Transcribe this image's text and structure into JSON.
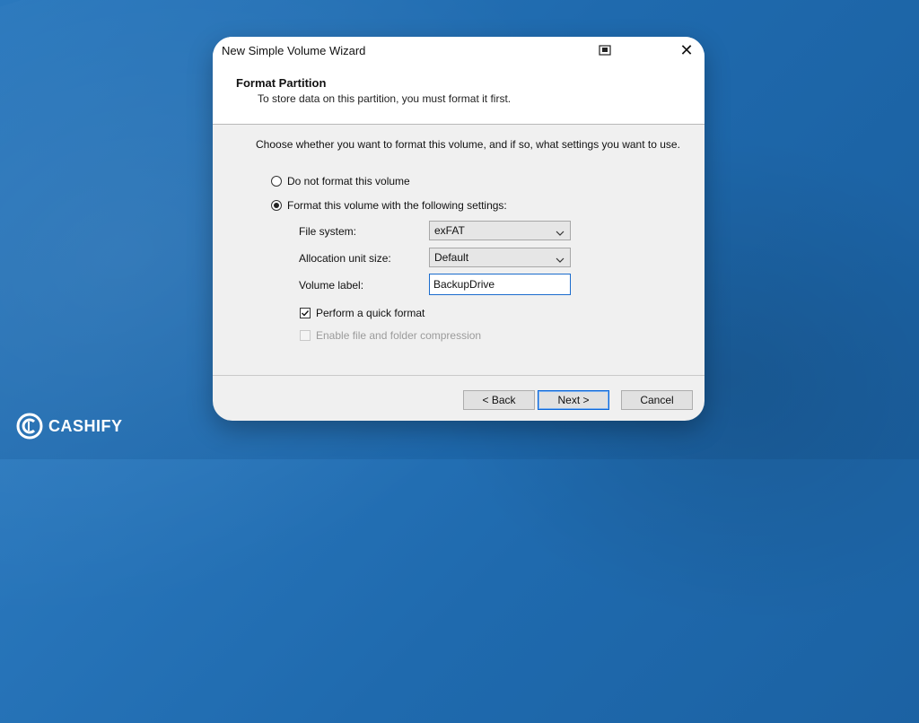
{
  "window": {
    "title": "New Simple Volume Wizard",
    "close_label": "✕"
  },
  "header": {
    "title": "Format Partition",
    "subtitle": "To store data on this partition, you must format it first."
  },
  "body": {
    "instruction": "Choose whether you want to format this volume, and if so, what settings you want to use.",
    "options": [
      {
        "label": "Do not format this volume",
        "selected": false
      },
      {
        "label": "Format this volume with the following settings:",
        "selected": true
      }
    ],
    "fields": {
      "file_system": {
        "label": "File system:",
        "value": "exFAT"
      },
      "allocation_unit_size": {
        "label": "Allocation unit size:",
        "value": "Default"
      },
      "volume_label": {
        "label": "Volume label:",
        "value": "BackupDrive"
      }
    },
    "checkboxes": [
      {
        "label": "Perform a quick format",
        "checked": true,
        "enabled": true
      },
      {
        "label": "Enable file and folder compression",
        "checked": false,
        "enabled": false
      }
    ]
  },
  "buttons": {
    "back": "< Back",
    "next": "Next >",
    "cancel": "Cancel"
  },
  "watermark": {
    "text": "CASHIFY"
  },
  "colors": {
    "desktop": "#1f6aae",
    "accent": "#0a66d8"
  }
}
